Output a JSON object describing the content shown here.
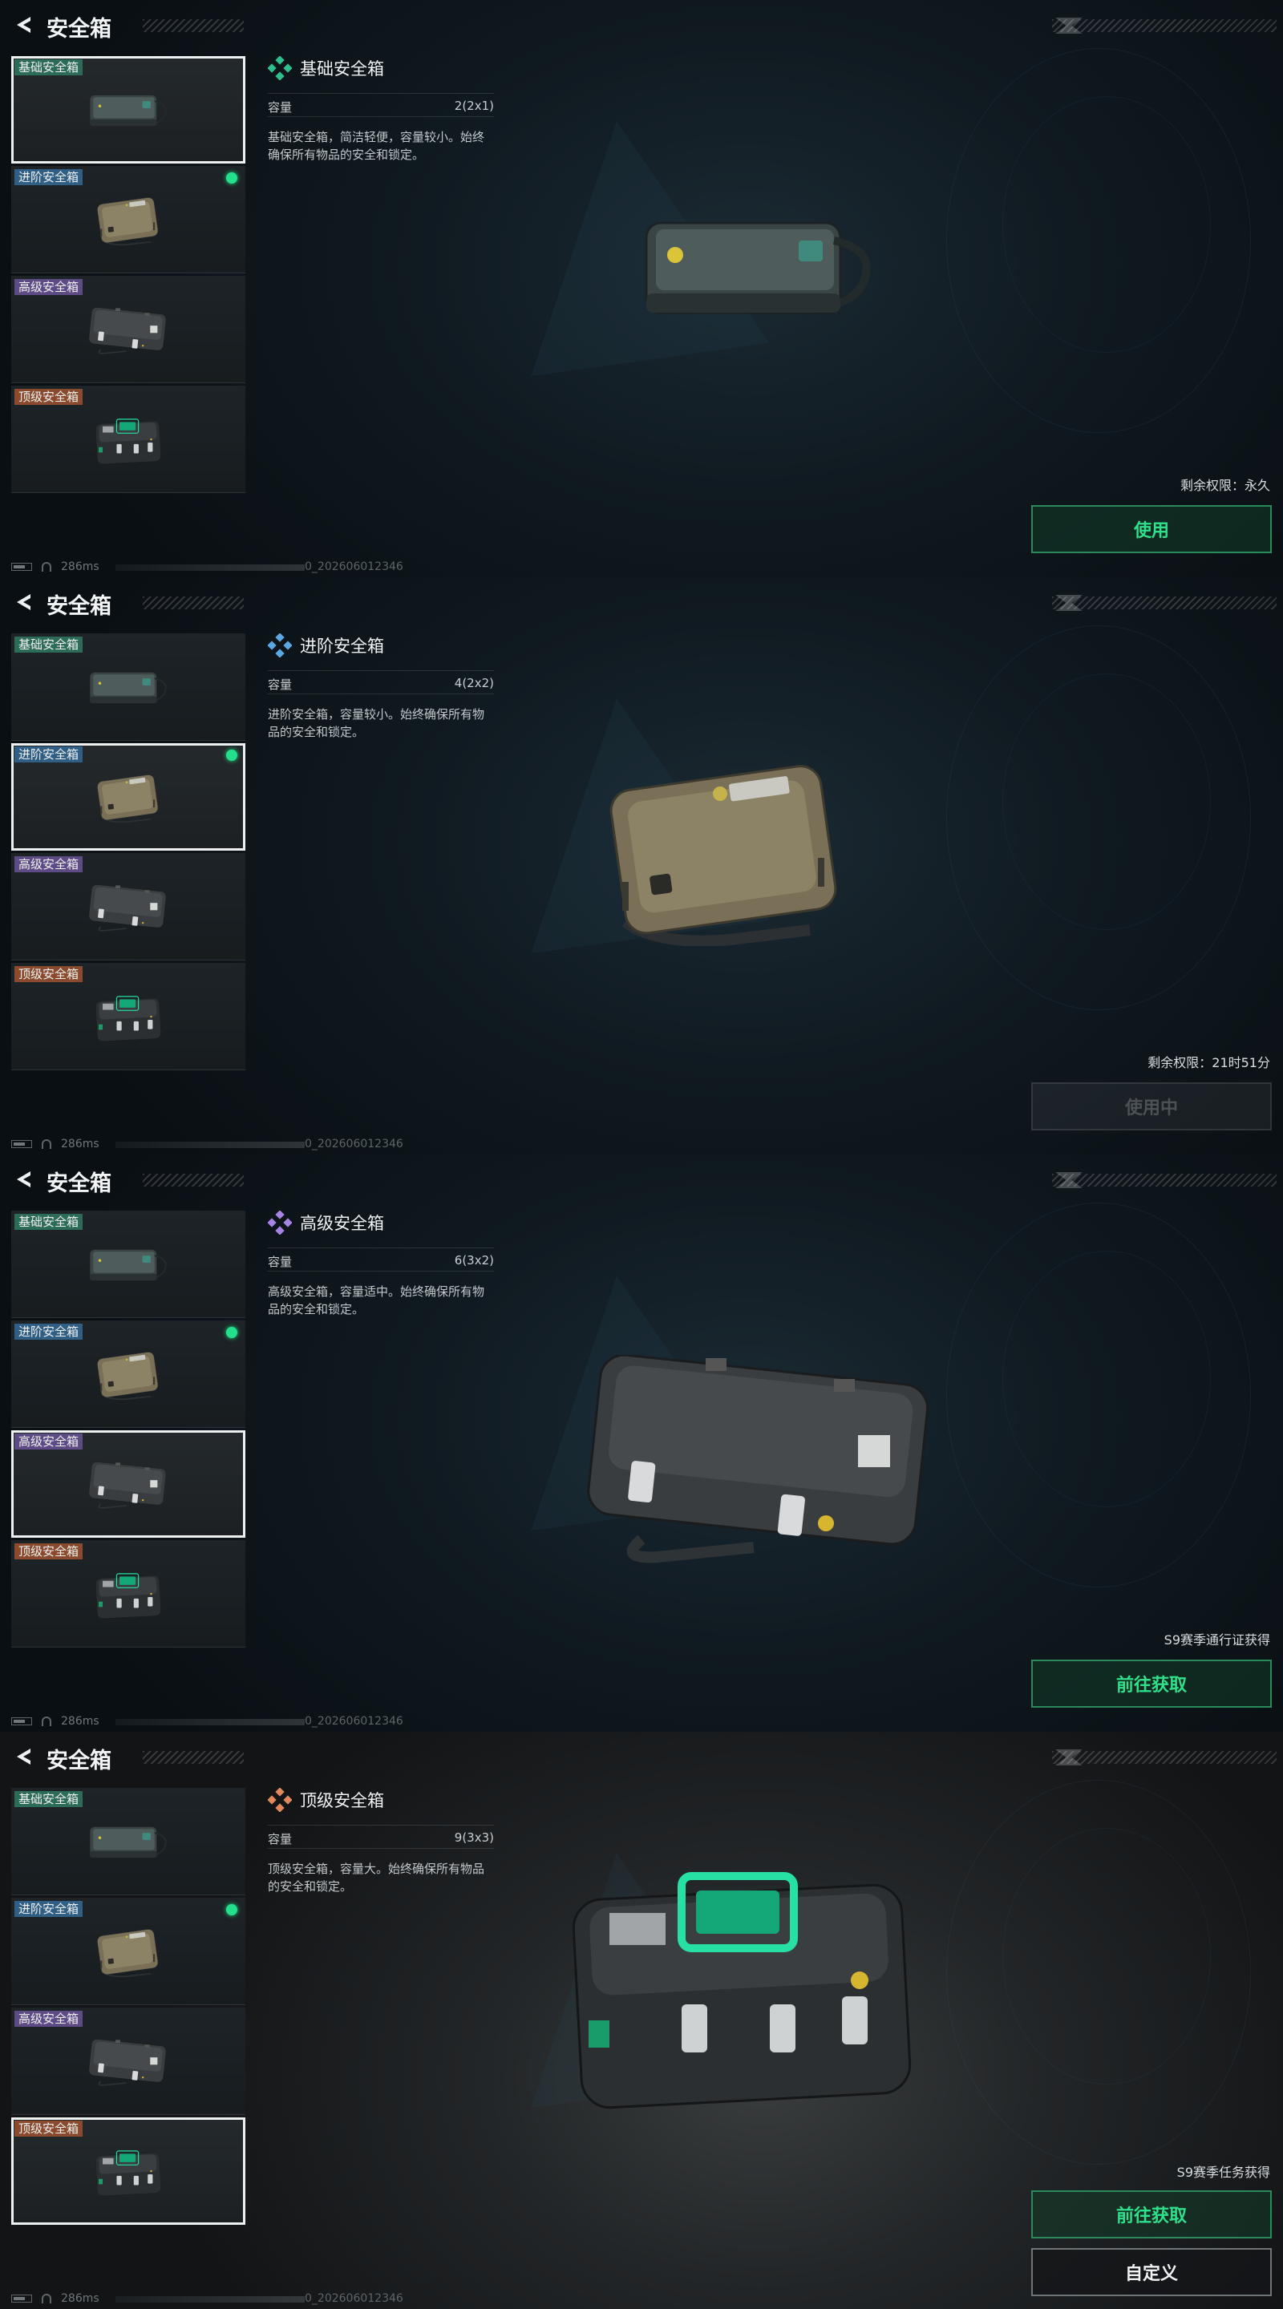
{
  "panels": [
    {
      "title": "安全箱",
      "list": [
        {
          "tag": "基础安全箱",
          "tier": "basic",
          "equipped": false,
          "selected": true
        },
        {
          "tag": "进阶安全箱",
          "tier": "advanced",
          "equipped": true,
          "selected": false
        },
        {
          "tag": "高级安全箱",
          "tier": "senior",
          "equipped": false,
          "selected": false
        },
        {
          "tag": "顶级安全箱",
          "tier": "top",
          "equipped": false,
          "selected": false
        }
      ],
      "detail": {
        "name": "基础安全箱",
        "rarity_color": "#2fbf8f",
        "capacity_label": "容量",
        "capacity_value": "2(2x1)",
        "description": "基础安全箱，简洁轻便，容量较小。始终确保所有物品的安全和锁定。"
      },
      "remain": "剩余权限：永久",
      "buttons": [
        {
          "label": "使用",
          "style": "green"
        }
      ],
      "status": {
        "ping": "286ms",
        "uid": "0_202606012346"
      }
    },
    {
      "title": "安全箱",
      "list": [
        {
          "tag": "基础安全箱",
          "tier": "basic",
          "equipped": false,
          "selected": false
        },
        {
          "tag": "进阶安全箱",
          "tier": "advanced",
          "equipped": true,
          "selected": true
        },
        {
          "tag": "高级安全箱",
          "tier": "senior",
          "equipped": false,
          "selected": false
        },
        {
          "tag": "顶级安全箱",
          "tier": "top",
          "equipped": false,
          "selected": false
        }
      ],
      "detail": {
        "name": "进阶安全箱",
        "rarity_color": "#5aa7e6",
        "capacity_label": "容量",
        "capacity_value": "4(2x2)",
        "description": "进阶安全箱，容量较小。始终确保所有物品的安全和锁定。"
      },
      "remain": "剩余权限：21时51分",
      "buttons": [
        {
          "label": "使用中",
          "style": "disabled"
        }
      ],
      "status": {
        "ping": "286ms",
        "uid": "0_202606012346"
      }
    },
    {
      "title": "安全箱",
      "list": [
        {
          "tag": "基础安全箱",
          "tier": "basic",
          "equipped": false,
          "selected": false
        },
        {
          "tag": "进阶安全箱",
          "tier": "advanced",
          "equipped": true,
          "selected": false
        },
        {
          "tag": "高级安全箱",
          "tier": "senior",
          "equipped": false,
          "selected": true
        },
        {
          "tag": "顶级安全箱",
          "tier": "top",
          "equipped": false,
          "selected": false
        }
      ],
      "detail": {
        "name": "高级安全箱",
        "rarity_color": "#a783e8",
        "capacity_label": "容量",
        "capacity_value": "6(3x2)",
        "description": "高级安全箱，容量适中。始终确保所有物品的安全和锁定。"
      },
      "remain": "S9赛季通行证获得",
      "buttons": [
        {
          "label": "前往获取",
          "style": "green"
        }
      ],
      "status": {
        "ping": "286ms",
        "uid": "0_202606012346"
      }
    },
    {
      "title": "安全箱",
      "list": [
        {
          "tag": "基础安全箱",
          "tier": "basic",
          "equipped": false,
          "selected": false
        },
        {
          "tag": "进阶安全箱",
          "tier": "advanced",
          "equipped": true,
          "selected": false
        },
        {
          "tag": "高级安全箱",
          "tier": "senior",
          "equipped": false,
          "selected": false
        },
        {
          "tag": "顶级安全箱",
          "tier": "top",
          "equipped": false,
          "selected": true
        }
      ],
      "detail": {
        "name": "顶级安全箱",
        "rarity_color": "#e0885a",
        "capacity_label": "容量",
        "capacity_value": "9(3x3)",
        "description": "顶级安全箱，容量大。始终确保所有物品的安全和锁定。"
      },
      "remain": "S9赛季任务获得",
      "buttons": [
        {
          "label": "前往获取",
          "style": "green"
        },
        {
          "label": "自定义",
          "style": "white"
        }
      ],
      "status": {
        "ping": "286ms",
        "uid": "0_202606012346"
      }
    }
  ]
}
